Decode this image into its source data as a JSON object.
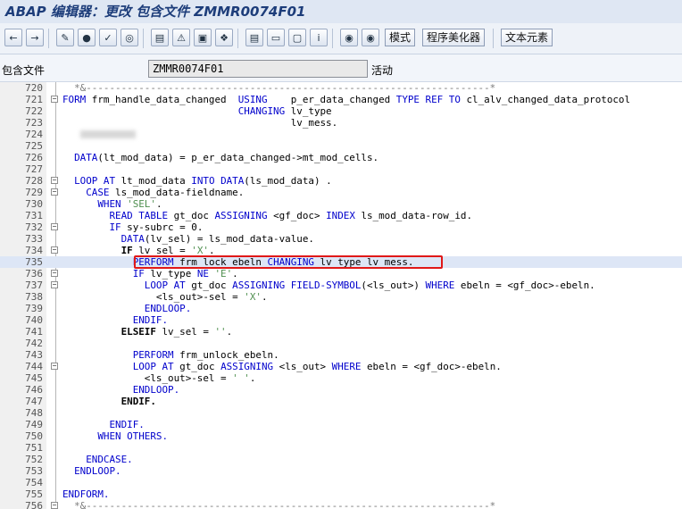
{
  "window": {
    "title": "ABAP 编辑器：更改 包含文件 ZMMR0074F01"
  },
  "toolbar": {
    "mode_label": "模式",
    "pretty_printer_label": "程序美化器",
    "text_elements_label": "文本元素"
  },
  "header": {
    "field_label": "包含文件",
    "field_value": "ZMMR0074F01",
    "status": "活动"
  },
  "colors": {
    "keyword": "#0000cc",
    "string": "#4f8f4f",
    "comment": "#7a7a7a",
    "highlight": "#dde6f6",
    "annotation": "#e01818"
  },
  "editor": {
    "lines": [
      {
        "num": "720",
        "tokens": [
          {
            "t": "  *&---------------------------------------------------------------------*",
            "c": "cmt"
          }
        ]
      },
      {
        "num": "721",
        "fold": "−",
        "tokens": [
          {
            "t": "FORM ",
            "c": "kw"
          },
          {
            "t": "frm_handle_data_changed  ",
            "c": "plain"
          },
          {
            "t": "USING",
            "c": "kw"
          },
          {
            "t": "    p_er_data_changed ",
            "c": "plain"
          },
          {
            "t": "TYPE REF TO ",
            "c": "kw"
          },
          {
            "t": "cl_alv_changed_data_protocol",
            "c": "plain"
          }
        ]
      },
      {
        "num": "722",
        "tokens": [
          {
            "t": "                              ",
            "c": "plain"
          },
          {
            "t": "CHANGING ",
            "c": "kw"
          },
          {
            "t": "lv_type",
            "c": "plain"
          }
        ]
      },
      {
        "num": "723",
        "tokens": [
          {
            "t": "                                       lv_mess.",
            "c": "plain"
          }
        ]
      },
      {
        "num": "724",
        "blur": true,
        "tokens": []
      },
      {
        "num": "725",
        "tokens": []
      },
      {
        "num": "726",
        "tokens": [
          {
            "t": "  ",
            "c": "plain"
          },
          {
            "t": "DATA",
            "c": "kw"
          },
          {
            "t": "(lt_mod_data) = p_er_data_changed->mt_mod_cells.",
            "c": "plain"
          }
        ]
      },
      {
        "num": "727",
        "tokens": []
      },
      {
        "num": "728",
        "fold": "−",
        "tokens": [
          {
            "t": "  ",
            "c": "plain"
          },
          {
            "t": "LOOP AT ",
            "c": "kw"
          },
          {
            "t": "lt_mod_data ",
            "c": "plain"
          },
          {
            "t": "INTO DATA",
            "c": "kw"
          },
          {
            "t": "(ls_mod_data) .",
            "c": "plain"
          }
        ]
      },
      {
        "num": "729",
        "fold": "−",
        "tokens": [
          {
            "t": "    ",
            "c": "plain"
          },
          {
            "t": "CASE ",
            "c": "kw"
          },
          {
            "t": "ls_mod_data-fieldname.",
            "c": "plain"
          }
        ]
      },
      {
        "num": "730",
        "tokens": [
          {
            "t": "      ",
            "c": "plain"
          },
          {
            "t": "WHEN ",
            "c": "kw"
          },
          {
            "t": "'SEL'",
            "c": "str"
          },
          {
            "t": ".",
            "c": "plain"
          }
        ]
      },
      {
        "num": "731",
        "tokens": [
          {
            "t": "        ",
            "c": "plain"
          },
          {
            "t": "READ TABLE ",
            "c": "kw"
          },
          {
            "t": "gt_doc ",
            "c": "plain"
          },
          {
            "t": "ASSIGNING ",
            "c": "kw"
          },
          {
            "t": "<gf_doc> ",
            "c": "plain"
          },
          {
            "t": "INDEX ",
            "c": "kw"
          },
          {
            "t": "ls_mod_data-row_id.",
            "c": "plain"
          }
        ]
      },
      {
        "num": "732",
        "fold": "−",
        "tokens": [
          {
            "t": "        ",
            "c": "plain"
          },
          {
            "t": "IF ",
            "c": "kw"
          },
          {
            "t": "sy-subrc = 0.",
            "c": "plain"
          }
        ]
      },
      {
        "num": "733",
        "tokens": [
          {
            "t": "          ",
            "c": "plain"
          },
          {
            "t": "DATA",
            "c": "kw"
          },
          {
            "t": "(lv_sel) = ls_mod_data-value.",
            "c": "plain"
          }
        ]
      },
      {
        "num": "734",
        "fold": "−",
        "tokens": [
          {
            "t": "          ",
            "c": "plain"
          },
          {
            "t": "IF ",
            "c": "bold"
          },
          {
            "t": "lv_sel = ",
            "c": "plain"
          },
          {
            "t": "'X'",
            "c": "str"
          },
          {
            "t": ".",
            "c": "plain"
          }
        ]
      },
      {
        "num": "735",
        "hl": true,
        "tokens": [
          {
            "t": "            ",
            "c": "plain"
          },
          {
            "t": "PERFORM ",
            "c": "kw"
          },
          {
            "t": "frm_lock_ebeln ",
            "c": "plain"
          },
          {
            "t": "CHANGING ",
            "c": "kw"
          },
          {
            "t": "lv_type lv_mess.",
            "c": "plain"
          }
        ]
      },
      {
        "num": "736",
        "fold": "−",
        "tokens": [
          {
            "t": "            ",
            "c": "plain"
          },
          {
            "t": "IF ",
            "c": "kw"
          },
          {
            "t": "lv_type ",
            "c": "plain"
          },
          {
            "t": "NE ",
            "c": "kw"
          },
          {
            "t": "'E'",
            "c": "str"
          },
          {
            "t": ".",
            "c": "plain"
          }
        ]
      },
      {
        "num": "737",
        "fold": "−",
        "tokens": [
          {
            "t": "              ",
            "c": "plain"
          },
          {
            "t": "LOOP AT ",
            "c": "kw"
          },
          {
            "t": "gt_doc ",
            "c": "plain"
          },
          {
            "t": "ASSIGNING FIELD-SYMBOL",
            "c": "kw"
          },
          {
            "t": "(<ls_out>) ",
            "c": "plain"
          },
          {
            "t": "WHERE ",
            "c": "kw"
          },
          {
            "t": "ebeln = <gf_doc>-ebeln.",
            "c": "plain"
          }
        ]
      },
      {
        "num": "738",
        "tokens": [
          {
            "t": "                <ls_out>-sel = ",
            "c": "plain"
          },
          {
            "t": "'X'",
            "c": "str"
          },
          {
            "t": ".",
            "c": "plain"
          }
        ]
      },
      {
        "num": "739",
        "tokens": [
          {
            "t": "              ",
            "c": "plain"
          },
          {
            "t": "ENDLOOP.",
            "c": "kw"
          }
        ]
      },
      {
        "num": "740",
        "tokens": [
          {
            "t": "            ",
            "c": "plain"
          },
          {
            "t": "ENDIF.",
            "c": "kw"
          }
        ]
      },
      {
        "num": "741",
        "tokens": [
          {
            "t": "          ",
            "c": "plain"
          },
          {
            "t": "ELSEIF ",
            "c": "bold"
          },
          {
            "t": "lv_sel = ",
            "c": "plain"
          },
          {
            "t": "''",
            "c": "str"
          },
          {
            "t": ".",
            "c": "plain"
          }
        ]
      },
      {
        "num": "742",
        "tokens": []
      },
      {
        "num": "743",
        "tokens": [
          {
            "t": "            ",
            "c": "plain"
          },
          {
            "t": "PERFORM ",
            "c": "kw"
          },
          {
            "t": "frm_unlock_ebeln.",
            "c": "plain"
          }
        ]
      },
      {
        "num": "744",
        "fold": "−",
        "tokens": [
          {
            "t": "            ",
            "c": "plain"
          },
          {
            "t": "LOOP AT ",
            "c": "kw"
          },
          {
            "t": "gt_doc ",
            "c": "plain"
          },
          {
            "t": "ASSIGNING ",
            "c": "kw"
          },
          {
            "t": "<ls_out> ",
            "c": "plain"
          },
          {
            "t": "WHERE ",
            "c": "kw"
          },
          {
            "t": "ebeln = <gf_doc>-ebeln.",
            "c": "plain"
          }
        ]
      },
      {
        "num": "745",
        "tokens": [
          {
            "t": "              <ls_out>-sel = ",
            "c": "plain"
          },
          {
            "t": "' '",
            "c": "str"
          },
          {
            "t": ".",
            "c": "plain"
          }
        ]
      },
      {
        "num": "746",
        "tokens": [
          {
            "t": "            ",
            "c": "plain"
          },
          {
            "t": "ENDLOOP.",
            "c": "kw"
          }
        ]
      },
      {
        "num": "747",
        "tokens": [
          {
            "t": "          ",
            "c": "plain"
          },
          {
            "t": "ENDIF.",
            "c": "bold"
          }
        ]
      },
      {
        "num": "748",
        "tokens": []
      },
      {
        "num": "749",
        "tokens": [
          {
            "t": "        ",
            "c": "plain"
          },
          {
            "t": "ENDIF.",
            "c": "kw"
          }
        ]
      },
      {
        "num": "750",
        "tokens": [
          {
            "t": "      ",
            "c": "plain"
          },
          {
            "t": "WHEN OTHERS.",
            "c": "kw"
          }
        ]
      },
      {
        "num": "751",
        "tokens": []
      },
      {
        "num": "752",
        "tokens": [
          {
            "t": "    ",
            "c": "plain"
          },
          {
            "t": "ENDCASE.",
            "c": "kw"
          }
        ]
      },
      {
        "num": "753",
        "tokens": [
          {
            "t": "  ",
            "c": "plain"
          },
          {
            "t": "ENDLOOP.",
            "c": "kw"
          }
        ]
      },
      {
        "num": "754",
        "tokens": []
      },
      {
        "num": "755",
        "tokens": [
          {
            "t": "ENDFORM.",
            "c": "kw"
          }
        ]
      },
      {
        "num": "756",
        "fold": "−",
        "tokens": [
          {
            "t": "  *&---------------------------------------------------------------------*",
            "c": "cmt"
          }
        ]
      }
    ]
  }
}
